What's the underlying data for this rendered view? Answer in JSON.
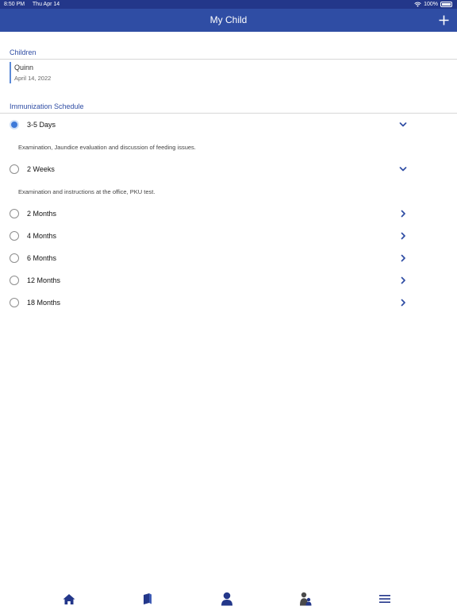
{
  "status_bar": {
    "time": "8:50 PM",
    "date": "Thu Apr 14",
    "battery": "100%"
  },
  "nav": {
    "title": "My Child",
    "add_icon": "plus-icon"
  },
  "children_section": {
    "header": "Children",
    "children": [
      {
        "name": "Quinn",
        "dob": "April 14, 2022"
      }
    ]
  },
  "schedule_section": {
    "header": "Immunization Schedule",
    "items": [
      {
        "label": "3-5 Days",
        "selected": true,
        "expanded": true,
        "description": "Examination, Jaundice evaluation and discussion of feeding issues."
      },
      {
        "label": "2 Weeks",
        "selected": false,
        "expanded": true,
        "description": "Examination and instructions at the office, PKU test."
      },
      {
        "label": "2 Months",
        "selected": false,
        "expanded": false
      },
      {
        "label": "4 Months",
        "selected": false,
        "expanded": false
      },
      {
        "label": "6 Months",
        "selected": false,
        "expanded": false
      },
      {
        "label": "12 Months",
        "selected": false,
        "expanded": false
      },
      {
        "label": "18 Months",
        "selected": false,
        "expanded": false
      }
    ]
  },
  "tab_bar": {
    "tabs": [
      {
        "icon": "home-icon"
      },
      {
        "icon": "book-icon"
      },
      {
        "icon": "person-icon"
      },
      {
        "icon": "parent-child-icon"
      },
      {
        "icon": "menu-icon"
      }
    ]
  },
  "colors": {
    "status_bar": "#23378a",
    "nav_bar": "#2f4da4",
    "accent": "#2f4da4",
    "selected_radio": "#3d79d8",
    "card_border": "#5b8ad8"
  }
}
